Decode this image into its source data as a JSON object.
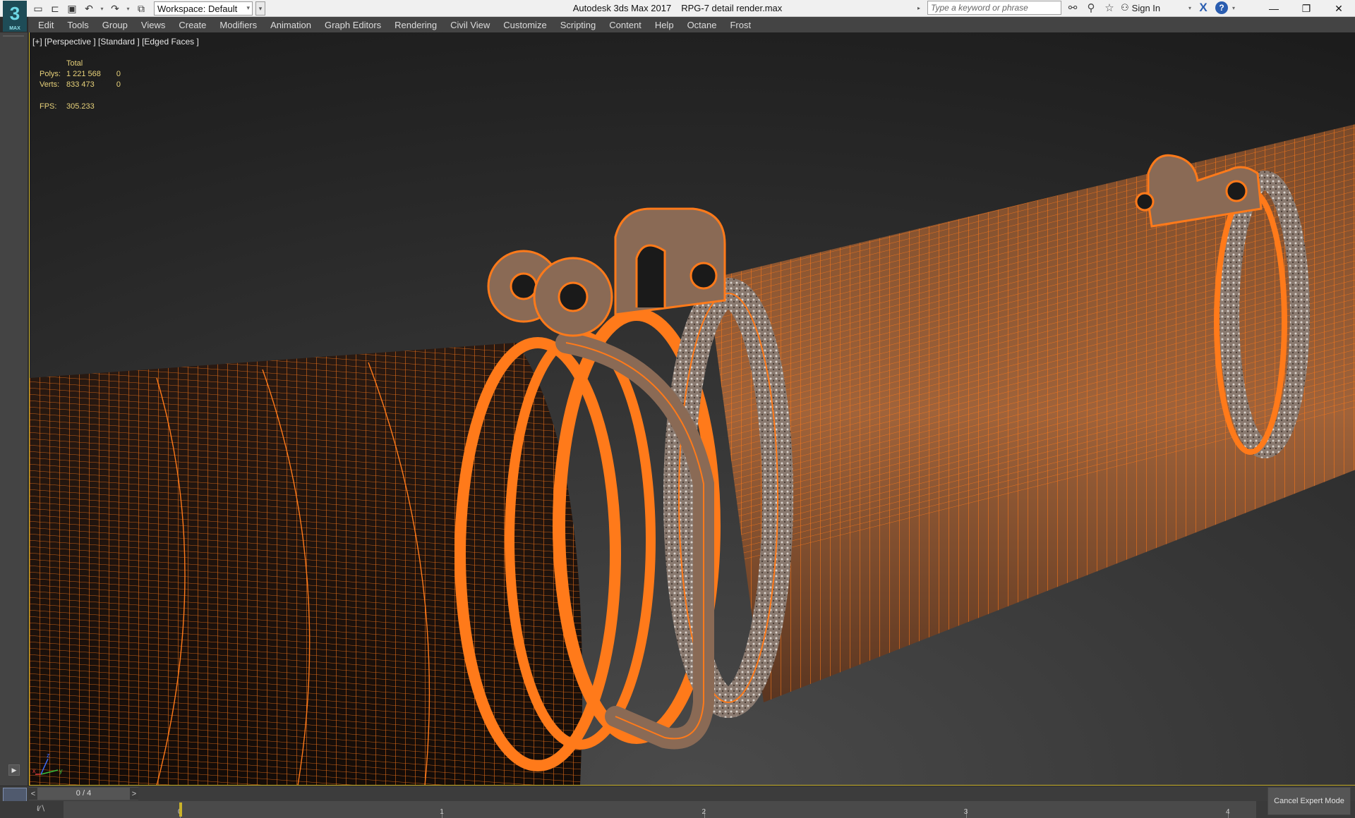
{
  "app": {
    "logo_text": "3",
    "logo_sub": "MAX",
    "product": "Autodesk 3ds Max 2017",
    "file": "RPG-7 detail render.max"
  },
  "quick_access": {
    "workspace_label": "Workspace: Default"
  },
  "search": {
    "placeholder": "Type a keyword or phrase"
  },
  "account": {
    "sign_in": "Sign In"
  },
  "menu": {
    "items": [
      "Edit",
      "Tools",
      "Group",
      "Views",
      "Create",
      "Modifiers",
      "Animation",
      "Graph Editors",
      "Rendering",
      "Civil View",
      "Customize",
      "Scripting",
      "Content",
      "Help",
      "Octane",
      "Frost"
    ]
  },
  "viewport": {
    "label": "[+] [Perspective ] [Standard ] [Edged Faces ]",
    "stats": {
      "total_header": "Total",
      "polys_label": "Polys:",
      "polys_total": "1 221 568",
      "polys_sel": "0",
      "verts_label": "Verts:",
      "verts_total": "833 473",
      "verts_sel": "0",
      "fps_label": "FPS:",
      "fps_value": "305.233"
    },
    "wire_color": "#ff7a1a",
    "gizmo": {
      "x": "x",
      "y": "y",
      "z": "z"
    }
  },
  "timeline": {
    "frame_display": "0 / 4",
    "prev": "<",
    "next": ">",
    "ticks": [
      "0",
      "1",
      "2",
      "3",
      "4"
    ],
    "current_frame": 0,
    "total_frames": 4
  },
  "status": {
    "expert_button": "Cancel Expert Mode"
  }
}
